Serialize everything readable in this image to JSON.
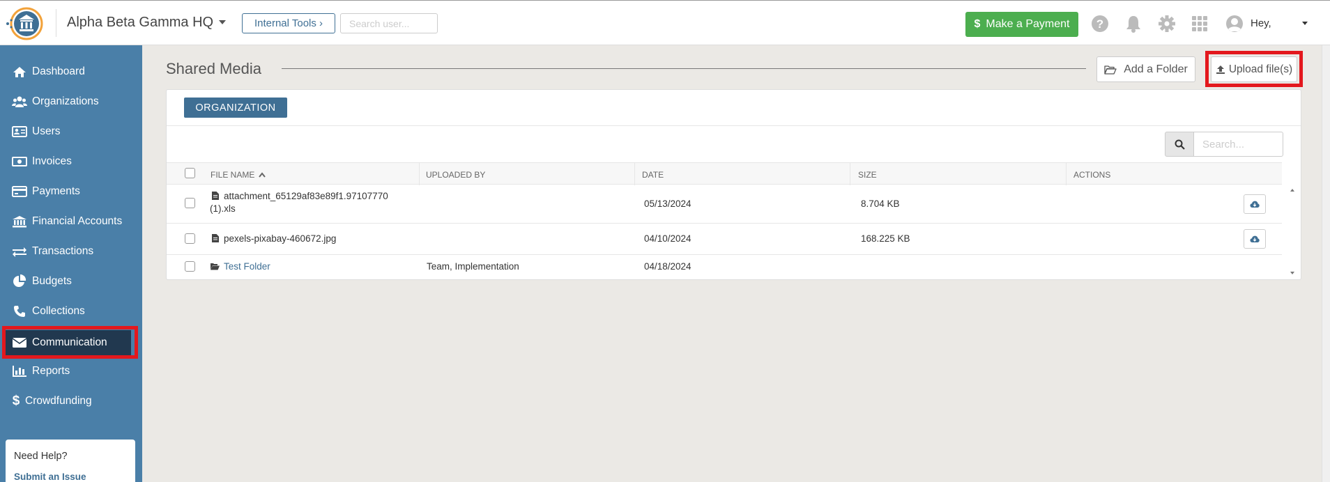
{
  "header": {
    "org_name": "Alpha Beta Gamma HQ",
    "internal_tools": "Internal Tools ›",
    "search_placeholder": "Search user...",
    "payment_label": "Make a Payment",
    "greeting": "Hey,"
  },
  "sidebar": {
    "items": [
      {
        "label": "Dashboard",
        "icon": "home-icon"
      },
      {
        "label": "Organizations",
        "icon": "people-icon"
      },
      {
        "label": "Users",
        "icon": "id-card-icon"
      },
      {
        "label": "Invoices",
        "icon": "money-icon"
      },
      {
        "label": "Payments",
        "icon": "credit-card-icon"
      },
      {
        "label": "Financial Accounts",
        "icon": "bank-icon"
      },
      {
        "label": "Transactions",
        "icon": "exchange-icon"
      },
      {
        "label": "Budgets",
        "icon": "pie-chart-icon"
      },
      {
        "label": "Collections",
        "icon": "phone-icon"
      },
      {
        "label": "Communication",
        "icon": "envelope-icon"
      },
      {
        "label": "Reports",
        "icon": "bar-chart-icon"
      },
      {
        "label": "Crowdfunding",
        "icon": "dollar-icon"
      }
    ],
    "active": "Communication",
    "help_title": "Need Help?",
    "help_link": "Submit an Issue"
  },
  "main": {
    "title": "Shared Media",
    "add_folder": "Add a Folder",
    "upload": "Upload file(s)",
    "tab": "ORGANIZATION",
    "search_placeholder": "Search...",
    "columns": [
      "FILE NAME",
      "UPLOADED BY",
      "DATE",
      "SIZE",
      "ACTIONS"
    ],
    "rows": [
      {
        "name_line1": "attachment_65129af83e89f1.97107770",
        "name_line2": "(1).xls",
        "uploaded_by": "",
        "date": "05/13/2024",
        "size": "8.704 KB",
        "type": "file"
      },
      {
        "name_line1": "pexels-pixabay-460672.jpg",
        "name_line2": "",
        "uploaded_by": "",
        "date": "04/10/2024",
        "size": "168.225 KB",
        "type": "file"
      },
      {
        "name_line1": "Test Folder",
        "name_line2": "",
        "uploaded_by": "Team, Implementation",
        "date": "04/18/2024",
        "size": "",
        "type": "folder"
      }
    ]
  },
  "colors": {
    "sidebar": "#4a7fa8",
    "sidebar_active": "#21384f",
    "accent": "#3f6f94",
    "success": "#4cae4f",
    "highlight": "#e3181d"
  }
}
